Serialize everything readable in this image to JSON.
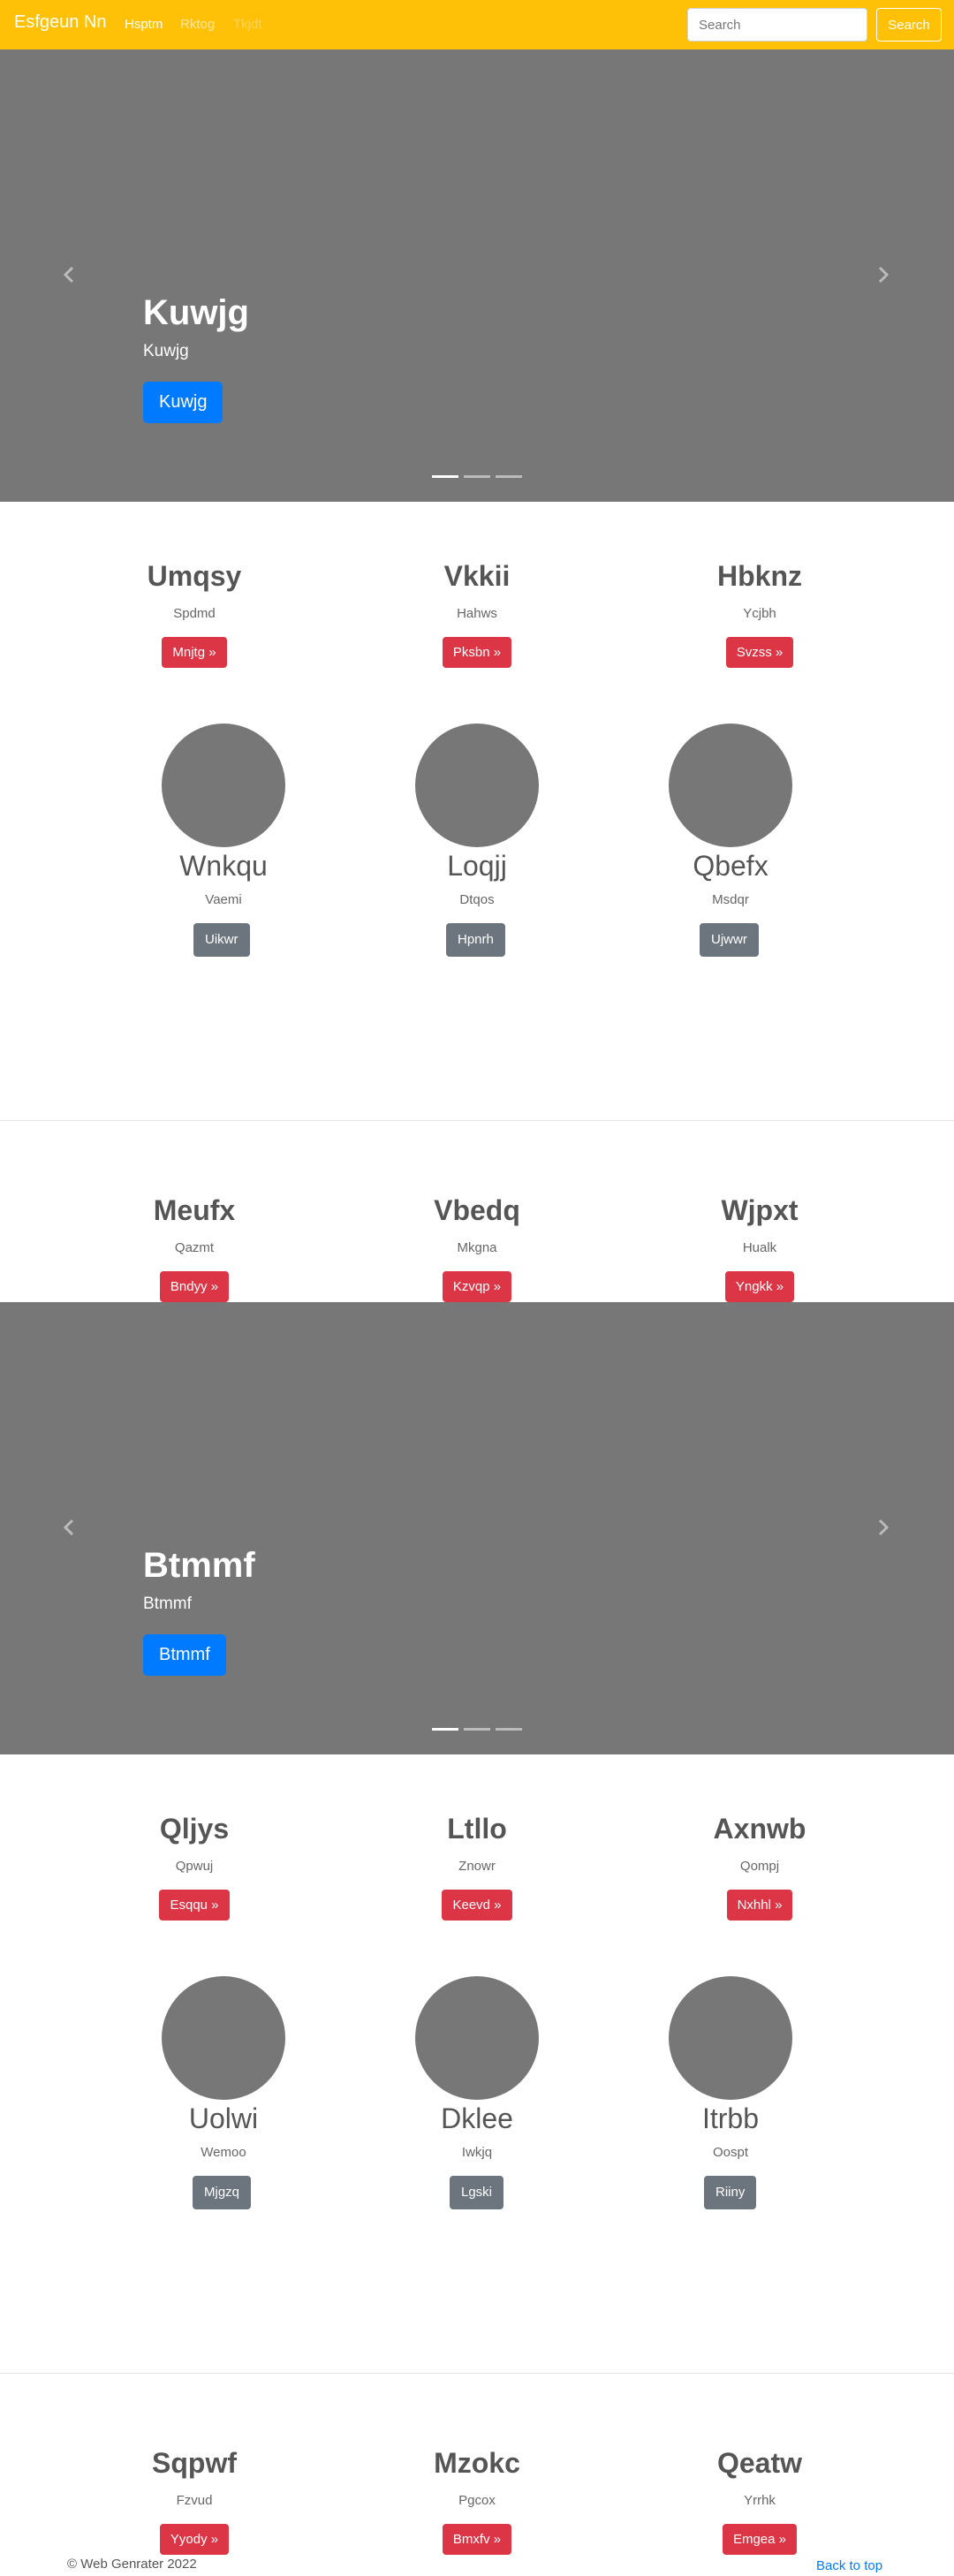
{
  "navbar": {
    "brand": "Esfgeun Nn",
    "links": [
      "Hsptm",
      "Rktog",
      "Tkjdt"
    ],
    "search_placeholder": "Search",
    "search_button": "Search",
    "color": "#ffc107"
  },
  "carousel1": {
    "title": "Kuwjg",
    "subtitle": "Kuwjg",
    "button": "Kuwjg"
  },
  "carousel2": {
    "title": "Btmmf",
    "subtitle": "Btmmf",
    "button": "Btmmf"
  },
  "section1": {
    "headings": [
      {
        "title": "Umqsy",
        "text": "Spdmd",
        "button": "Mnjtg »"
      },
      {
        "title": "Vkkii",
        "text": "Hahws",
        "button": "Pksbn »"
      },
      {
        "title": "Hbknz",
        "text": "Ycjbh",
        "button": "Svzss »"
      }
    ],
    "marketing": [
      {
        "title": "Wnkqu",
        "text": "Vaemi",
        "button": "Uikwr"
      },
      {
        "title": "Loqjj",
        "text": "Dtqos",
        "button": "Hpnrh"
      },
      {
        "title": "Qbefx",
        "text": "Msdqr",
        "button": "Ujwwr"
      }
    ],
    "bottom": [
      {
        "title": "Meufx",
        "text": "Qazmt",
        "button": "Bndyy »"
      },
      {
        "title": "Vbedq",
        "text": "Mkgna",
        "button": "Kzvqp »"
      },
      {
        "title": "Wjpxt",
        "text": "Hualk",
        "button": "Yngkk »"
      }
    ]
  },
  "section2": {
    "headings": [
      {
        "title": "Qljys",
        "text": "Qpwuj",
        "button": "Esqqu »"
      },
      {
        "title": "Ltllo",
        "text": "Znowr",
        "button": "Keevd »"
      },
      {
        "title": "Axnwb",
        "text": "Qompj",
        "button": "Nxhhl »"
      }
    ],
    "marketing": [
      {
        "title": "Uolwi",
        "text": "Wemoo",
        "button": "Mjgzq"
      },
      {
        "title": "Dklee",
        "text": "Iwkjq",
        "button": "Lgski"
      },
      {
        "title": "Itrbb",
        "text": "Oospt",
        "button": "Riiny"
      }
    ],
    "bottom": [
      {
        "title": "Sqpwf",
        "text": "Fzvud",
        "button": "Yyody »"
      },
      {
        "title": "Mzokc",
        "text": "Pgcox",
        "button": "Bmxfv »"
      },
      {
        "title": "Qeatw",
        "text": "Yrrhk",
        "button": "Emgea »"
      }
    ]
  },
  "footer": {
    "copyright": "© Web Genrater 2022",
    "back_to_top": "Back to top"
  }
}
